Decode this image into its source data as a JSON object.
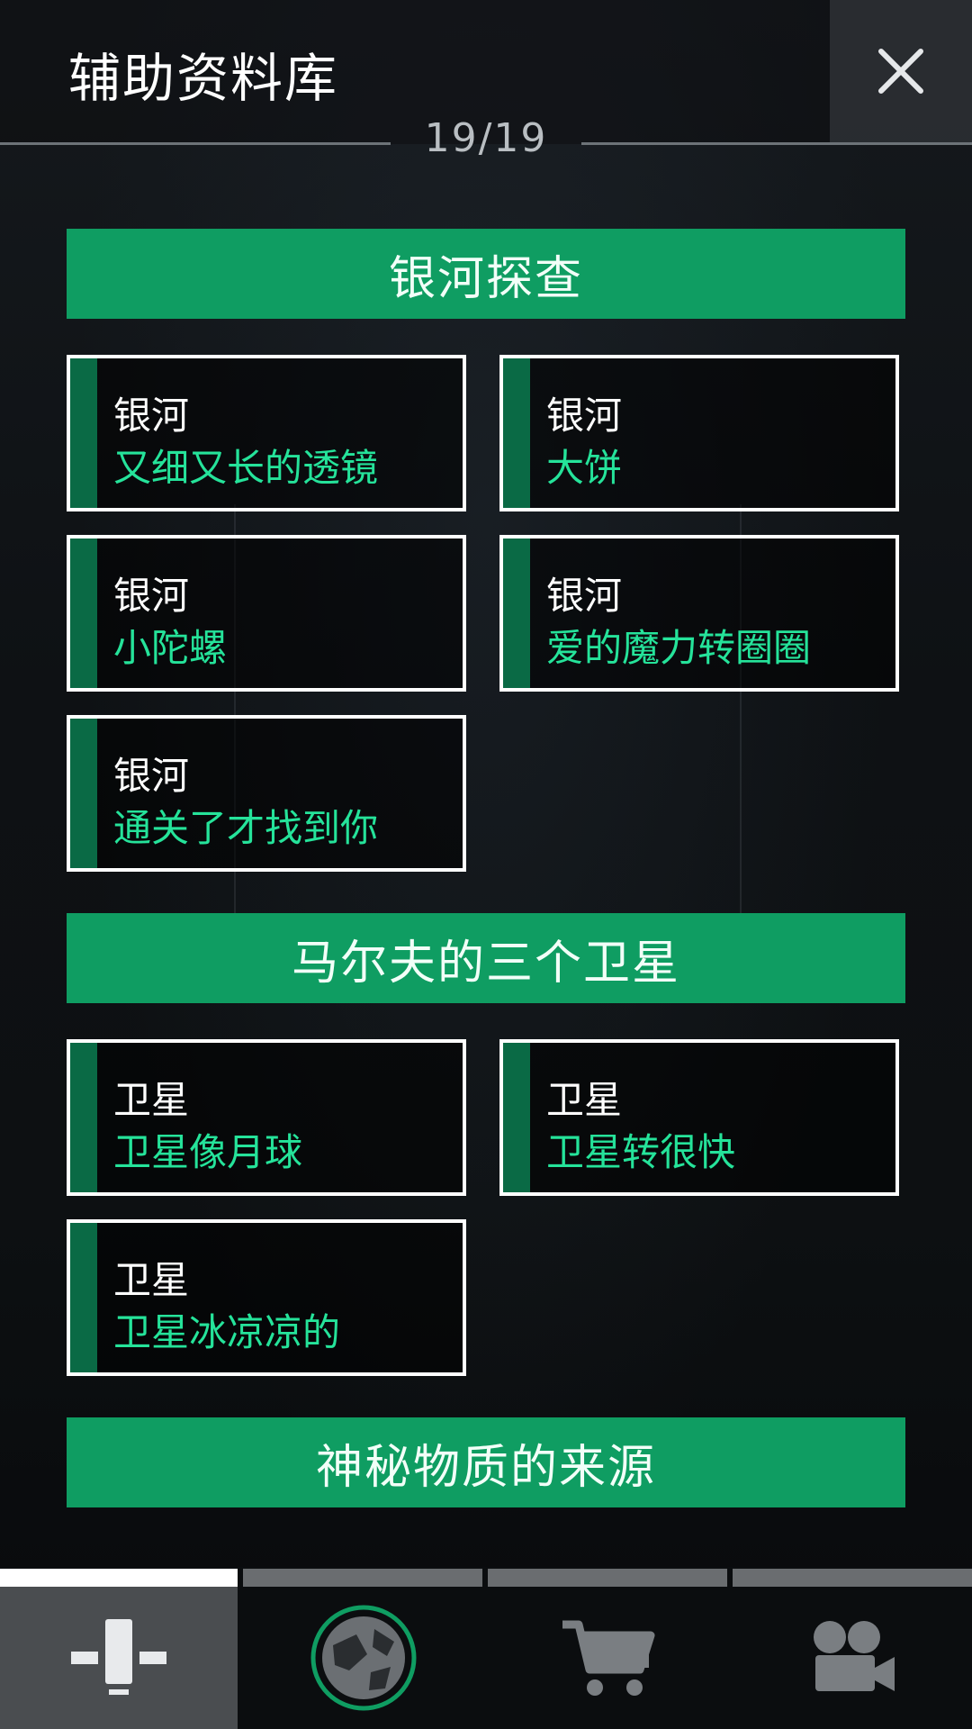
{
  "header": {
    "title": "辅助资料库",
    "counter": "19/19"
  },
  "sections": [
    {
      "title": "银河探查",
      "cards": [
        {
          "category": "银河",
          "name": "又细又长的透镜"
        },
        {
          "category": "银河",
          "name": "大饼"
        },
        {
          "category": "银河",
          "name": "小陀螺"
        },
        {
          "category": "银河",
          "name": "爱的魔力转圈圈"
        },
        {
          "category": "银河",
          "name": "通关了才找到你"
        }
      ]
    },
    {
      "title": "马尔夫的三个卫星",
      "cards": [
        {
          "category": "卫星",
          "name": "卫星像月球"
        },
        {
          "category": "卫星",
          "name": "卫星转很快"
        },
        {
          "category": "卫星",
          "name": "卫星冰凉凉的"
        }
      ]
    },
    {
      "title": "神秘物质的来源",
      "cards": []
    }
  ],
  "tabs": [
    {
      "icon": "pin-icon",
      "active": true
    },
    {
      "icon": "planet-icon",
      "active": false
    },
    {
      "icon": "cart-icon",
      "active": false
    },
    {
      "icon": "video-camera-icon",
      "active": false
    }
  ],
  "colors": {
    "accent": "#0f9d62",
    "accent_text": "#25e39a",
    "stripe": "#0a6a45"
  }
}
